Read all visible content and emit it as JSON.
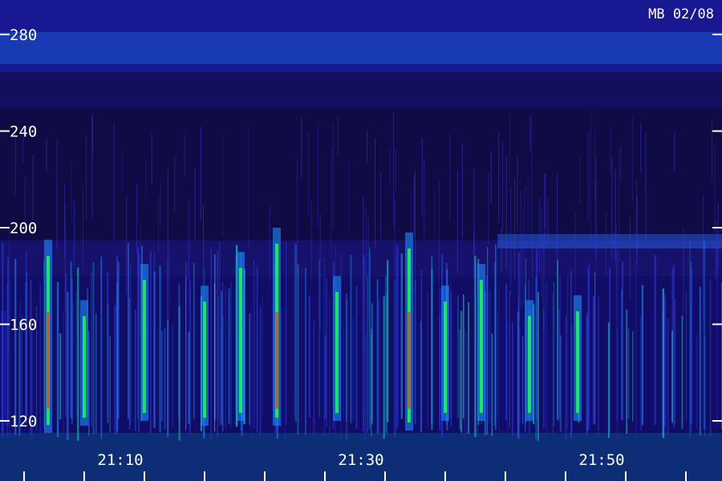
{
  "chart_data": {
    "type": "heatmap",
    "subtype": "spectrogram",
    "corner_label": "MB 02/08",
    "y_ticks": [
      120,
      160,
      200,
      240,
      280
    ],
    "y_tick_labels": [
      "120",
      "160",
      "200",
      "240",
      "280"
    ],
    "x_ticks": [
      "21:10",
      "21:30",
      "21:50"
    ],
    "ylim": [
      113,
      293
    ],
    "x_range_minutes": [
      "21:02",
      "21:51"
    ],
    "colors": {
      "background": "#0c0420",
      "low": "#1a12a8",
      "mid": "#1a8cff",
      "high": "#19ff4a",
      "peak": "#ff2a1a"
    },
    "events": [
      {
        "t": "21:04",
        "f_low": 115,
        "f_high": 195,
        "intensity": 1.0
      },
      {
        "t": "21:07",
        "f_low": 118,
        "f_high": 170,
        "intensity": 0.6
      },
      {
        "t": "21:12",
        "f_low": 120,
        "f_high": 185,
        "intensity": 0.55
      },
      {
        "t": "21:17",
        "f_low": 118,
        "f_high": 176,
        "intensity": 0.6
      },
      {
        "t": "21:20",
        "f_low": 120,
        "f_high": 190,
        "intensity": 0.7
      },
      {
        "t": "21:23",
        "f_low": 118,
        "f_high": 200,
        "intensity": 0.95
      },
      {
        "t": "21:28",
        "f_low": 120,
        "f_high": 180,
        "intensity": 0.5
      },
      {
        "t": "21:34",
        "f_low": 116,
        "f_high": 198,
        "intensity": 0.9
      },
      {
        "t": "21:37",
        "f_low": 120,
        "f_high": 176,
        "intensity": 0.6
      },
      {
        "t": "21:40",
        "f_low": 120,
        "f_high": 185,
        "intensity": 0.55
      },
      {
        "t": "21:44",
        "f_low": 120,
        "f_high": 170,
        "intensity": 0.45
      },
      {
        "t": "21:48",
        "f_low": 120,
        "f_high": 172,
        "intensity": 0.45
      }
    ]
  }
}
